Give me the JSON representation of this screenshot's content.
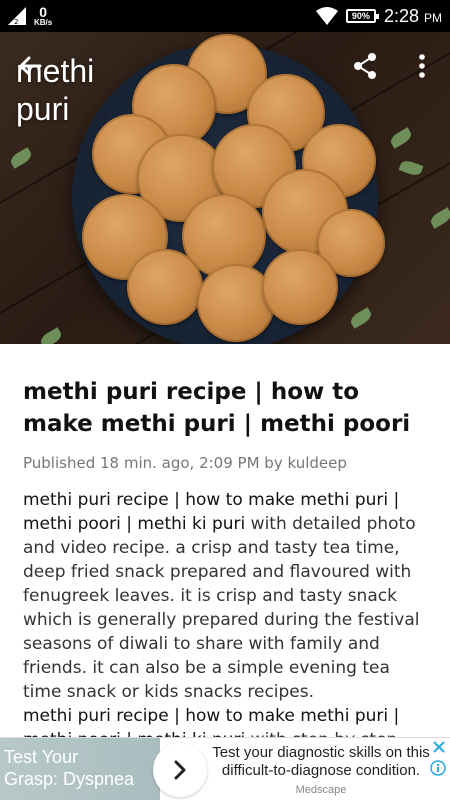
{
  "status_bar": {
    "network_speed": "0",
    "network_unit": "KB/s",
    "signal_sim": "2",
    "battery": "90%",
    "time": "2:28",
    "ampm": "PM"
  },
  "hero": {
    "title_line1": "methi",
    "title_line2": "puri",
    "icons": [
      "back-icon",
      "share-icon",
      "more-icon"
    ]
  },
  "article": {
    "headline": "methi puri recipe | how to make methi puri | methi poori",
    "meta": "Published 18 min. ago, 2:09 PM by kuldeep",
    "para1_bold": "methi puri recipe | how to make methi puri | methi poori | methi ki puri",
    "para1_rest": " with detailed photo and video recipe. a crisp and tasty tea time, deep fried snack prepared and flavoured with fenugreek leaves. it is crisp and tasty snack which is generally prepared during the festival seasons of diwali to share with family and friends. it can also be a simple evening tea time snack or kids snacks recipes.",
    "para2_bold": "methi puri recipe | how to make methi puri | methi poori | methi ki puri",
    "para2_rest": " with step by step"
  },
  "ad": {
    "left_text_line1": "Test Your",
    "left_text_line2": "Grasp: Dyspnea",
    "text": "Test your diagnostic skills on this difficult-to-diagnose condition.",
    "source": "Medscape"
  },
  "colors": {
    "status_bar": "#000000",
    "ad_close": "#2aa8e0",
    "text_primary": "#111111",
    "text_meta": "#777777"
  }
}
